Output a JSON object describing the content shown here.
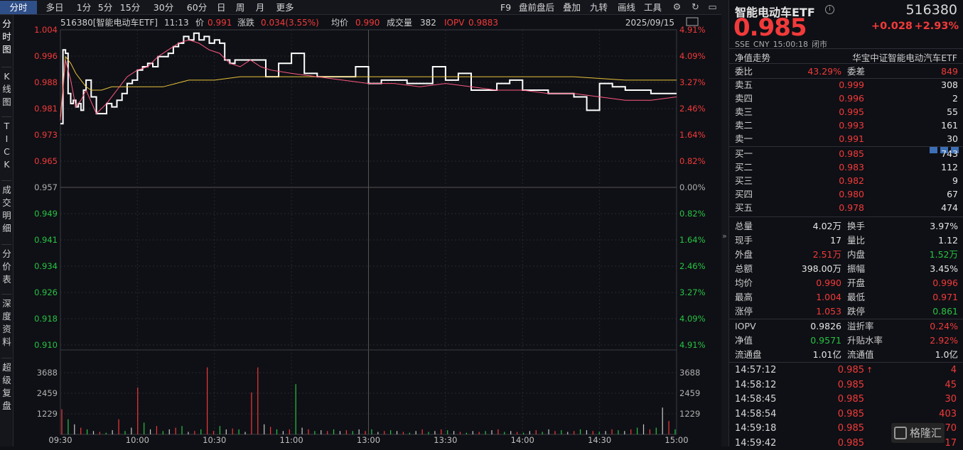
{
  "toolbar": {
    "tabs": [
      "分时",
      "多日",
      "1分",
      "5分",
      "15分",
      "30分",
      "60分",
      "日",
      "周",
      "月",
      "更多"
    ],
    "tools": [
      "F9",
      "盘前盘后",
      "叠加",
      "九转",
      "画线",
      "工具"
    ]
  },
  "leftbar": {
    "items": [
      [
        "分",
        "时",
        "图"
      ],
      [
        "K",
        "线",
        "图"
      ],
      [
        "T",
        "I",
        "C",
        "K"
      ],
      [
        "成",
        "交",
        "明",
        "细"
      ],
      [
        "分",
        "价",
        "表"
      ],
      [
        "深",
        "度",
        "资",
        "料"
      ],
      [
        "超",
        "级",
        "复",
        "盘"
      ]
    ]
  },
  "info": {
    "code_name": "516380[智能电动车ETF]",
    "time": "11:13",
    "price_label": "价",
    "price": "0.991",
    "change_label": "涨跌",
    "change": "0.034(3.55%)",
    "avg_label": "均价",
    "avg": "0.990",
    "vol_label": "成交量",
    "vol": "382",
    "iopv_label": "IOPV",
    "iopv": "0.9883",
    "date": "2025/09/15"
  },
  "axes": {
    "price_ticks": [
      "1.004",
      "0.996",
      "0.988",
      "0.981",
      "0.973",
      "0.965",
      "0.957",
      "0.949",
      "0.941",
      "0.934",
      "0.926",
      "0.918",
      "0.910"
    ],
    "pct_ticks": [
      "4.91%",
      "4.09%",
      "3.27%",
      "2.46%",
      "1.64%",
      "0.82%",
      "0.00%",
      "0.82%",
      "1.64%",
      "2.46%",
      "3.27%",
      "4.09%",
      "4.91%"
    ],
    "vol_ticks": [
      "3688",
      "2459",
      "1229"
    ],
    "time_ticks": [
      "09:30",
      "10:00",
      "10:30",
      "11:00",
      "13:00",
      "13:30",
      "14:00",
      "14:30",
      "15:00"
    ]
  },
  "chart_data": {
    "type": "line",
    "series": [
      {
        "name": "价",
        "color": "#ffffff",
        "x": [
          0,
          1,
          2,
          3,
          4,
          5,
          6,
          7,
          8,
          9,
          10,
          12,
          14,
          16,
          18,
          20,
          22,
          24,
          26,
          28,
          30,
          32,
          34,
          36,
          38,
          40,
          42,
          44,
          46,
          48,
          50,
          52,
          54,
          56,
          58,
          60,
          62,
          64,
          66,
          68,
          70,
          72,
          74,
          76,
          78,
          80,
          85,
          90,
          95,
          100,
          105,
          110,
          115,
          120,
          125,
          130,
          135,
          140,
          145,
          150,
          155,
          160,
          165,
          170,
          175,
          180,
          185,
          190,
          195,
          200,
          205,
          210,
          215,
          220,
          225,
          230,
          235,
          240
        ],
        "y": [
          0.976,
          0.998,
          0.997,
          0.985,
          0.982,
          0.983,
          0.981,
          0.982,
          0.98,
          0.986,
          0.989,
          0.984,
          0.979,
          0.979,
          0.982,
          0.981,
          0.983,
          0.985,
          0.988,
          0.989,
          0.992,
          0.993,
          0.994,
          0.993,
          0.996,
          0.996,
          0.997,
          0.999,
          1.0,
          1.002,
          1.001,
          1.003,
          1.001,
          1.002,
          1.0,
          1.001,
          1.0,
          0.995,
          0.994,
          0.995,
          0.995,
          0.995,
          0.995,
          0.995,
          0.995,
          0.99,
          0.994,
          0.997,
          0.991,
          0.99,
          0.99,
          0.99,
          0.993,
          0.988,
          0.989,
          0.989,
          0.988,
          0.988,
          0.993,
          0.989,
          0.991,
          0.986,
          0.986,
          0.988,
          0.989,
          0.986,
          0.986,
          0.985,
          0.985,
          0.984,
          0.98,
          0.988,
          0.987,
          0.986,
          0.986,
          0.985,
          0.985,
          0.985
        ]
      },
      {
        "name": "均价",
        "color": "#e8c23a",
        "x": [
          0,
          2,
          4,
          6,
          8,
          10,
          12,
          16,
          20,
          25,
          30,
          35,
          40,
          45,
          50,
          60,
          70,
          80,
          100,
          120,
          140,
          160,
          180,
          200,
          220,
          240
        ],
        "y": [
          0.978,
          0.996,
          0.994,
          0.991,
          0.989,
          0.987,
          0.986,
          0.986,
          0.987,
          0.987,
          0.987,
          0.987,
          0.987,
          0.988,
          0.989,
          0.989,
          0.99,
          0.99,
          0.99,
          0.99,
          0.99,
          0.99,
          0.99,
          0.99,
          0.989,
          0.989
        ]
      },
      {
        "name": "IOPV",
        "color": "#ff5a82",
        "x": [
          0,
          2,
          4,
          6,
          8,
          10,
          14,
          18,
          22,
          26,
          30,
          34,
          38,
          42,
          46,
          50,
          54,
          58,
          62,
          66,
          70,
          74,
          78,
          82,
          90,
          100,
          110,
          120,
          130,
          140,
          150,
          160,
          170,
          180,
          190,
          200,
          210,
          220,
          230,
          240
        ],
        "y": [
          0.977,
          0.995,
          0.989,
          0.981,
          0.983,
          0.986,
          0.979,
          0.982,
          0.986,
          0.99,
          0.992,
          0.993,
          0.996,
          0.998,
          1.0,
          1.001,
          1.0,
          0.998,
          0.997,
          0.994,
          0.993,
          0.995,
          0.993,
          0.992,
          0.991,
          0.99,
          0.989,
          0.988,
          0.988,
          0.987,
          0.988,
          0.987,
          0.986,
          0.986,
          0.985,
          0.985,
          0.984,
          0.983,
          0.983,
          0.984
        ]
      }
    ],
    "volumes": [
      1500,
      900,
      600,
      400,
      300,
      200,
      150,
      100,
      250,
      900,
      200,
      400,
      2800,
      700,
      300,
      500,
      200,
      300,
      400,
      500,
      150,
      200,
      300,
      4000,
      200,
      500,
      300,
      350,
      300,
      150,
      2500,
      4000,
      600,
      450,
      300,
      200,
      300,
      3000,
      400,
      300,
      200,
      250,
      200,
      300,
      200,
      250,
      200,
      300,
      200,
      300,
      150,
      200,
      250,
      200,
      150,
      100,
      200,
      300,
      150,
      200,
      300,
      250,
      200,
      150,
      100,
      200,
      150,
      200,
      250,
      300,
      150,
      200,
      150,
      100,
      200,
      250,
      150,
      300,
      200,
      250,
      150,
      200,
      300,
      250,
      200,
      150,
      200,
      300,
      250,
      200,
      300,
      400,
      600,
      300,
      400,
      1600,
      800,
      300
    ],
    "xlim": [
      0,
      240
    ],
    "ylim": [
      0.91,
      1.004
    ],
    "prev_close": 0.957,
    "vol_max": 4915
  },
  "panel": {
    "name": "智能电动车ETF",
    "code": "516380",
    "price": "0.985",
    "change": "+0.028",
    "change_pct": "+2.93%",
    "exchange": "SSE",
    "currency": "CNY",
    "time": "15:00:18",
    "status": "闭市",
    "nav_trend": "净值走势",
    "index_name": "华宝中证智能电动汽车ETF",
    "ratio_label": "委比",
    "ratio": "43.29%",
    "diff_label": "委差",
    "diff": "849",
    "asks": [
      {
        "label": "卖五",
        "price": "0.999",
        "vol": "308"
      },
      {
        "label": "卖四",
        "price": "0.996",
        "vol": "2"
      },
      {
        "label": "卖三",
        "price": "0.995",
        "vol": "55"
      },
      {
        "label": "卖二",
        "price": "0.993",
        "vol": "161"
      },
      {
        "label": "卖一",
        "price": "0.991",
        "vol": "30"
      }
    ],
    "bids": [
      {
        "label": "买一",
        "price": "0.985",
        "vol": "743"
      },
      {
        "label": "买二",
        "price": "0.983",
        "vol": "112"
      },
      {
        "label": "买三",
        "price": "0.982",
        "vol": "9"
      },
      {
        "label": "买四",
        "price": "0.980",
        "vol": "67"
      },
      {
        "label": "买五",
        "price": "0.978",
        "vol": "474"
      }
    ],
    "stats": [
      {
        "l1": "总量",
        "v1": "4.02万",
        "c1": "white",
        "l2": "换手",
        "v2": "3.97%",
        "c2": "white"
      },
      {
        "l1": "现手",
        "v1": "17",
        "c1": "white",
        "l2": "量比",
        "v2": "1.12",
        "c2": "white"
      },
      {
        "l1": "外盘",
        "v1": "2.51万",
        "c1": "red",
        "l2": "内盘",
        "v2": "1.52万",
        "c2": "green"
      },
      {
        "l1": "总额",
        "v1": "398.00万",
        "c1": "white",
        "l2": "振幅",
        "v2": "3.45%",
        "c2": "white"
      },
      {
        "l1": "均价",
        "v1": "0.990",
        "c1": "red",
        "l2": "开盘",
        "v2": "0.996",
        "c2": "red"
      },
      {
        "l1": "最高",
        "v1": "1.004",
        "c1": "red",
        "l2": "最低",
        "v2": "0.971",
        "c2": "red"
      },
      {
        "l1": "涨停",
        "v1": "1.053",
        "c1": "red",
        "l2": "跌停",
        "v2": "0.861",
        "c2": "green"
      }
    ],
    "stats2": [
      {
        "l1": "IOPV",
        "v1": "0.9826",
        "c1": "white",
        "l2": "溢折率",
        "v2": "0.24%",
        "c2": "red"
      },
      {
        "l1": "净值",
        "v1": "0.9571",
        "c1": "green",
        "l2": "升贴水率",
        "v2": "2.92%",
        "c2": "red"
      },
      {
        "l1": "流通盘",
        "v1": "1.01亿",
        "c1": "white",
        "l2": "流通值",
        "v2": "1.0亿",
        "c2": "white"
      }
    ],
    "ticks": [
      {
        "t": "14:57:12",
        "p": "0.985",
        "arrow": "up",
        "v": "4"
      },
      {
        "t": "14:58:12",
        "p": "0.985",
        "arrow": "",
        "v": "45"
      },
      {
        "t": "14:58:45",
        "p": "0.985",
        "arrow": "",
        "v": "30"
      },
      {
        "t": "14:58:54",
        "p": "0.985",
        "arrow": "",
        "v": "403"
      },
      {
        "t": "14:59:18",
        "p": "0.985",
        "arrow": "",
        "v": "70"
      },
      {
        "t": "14:59:42",
        "p": "0.985",
        "arrow": "",
        "v": "17"
      }
    ],
    "watermark": "格隆汇"
  }
}
